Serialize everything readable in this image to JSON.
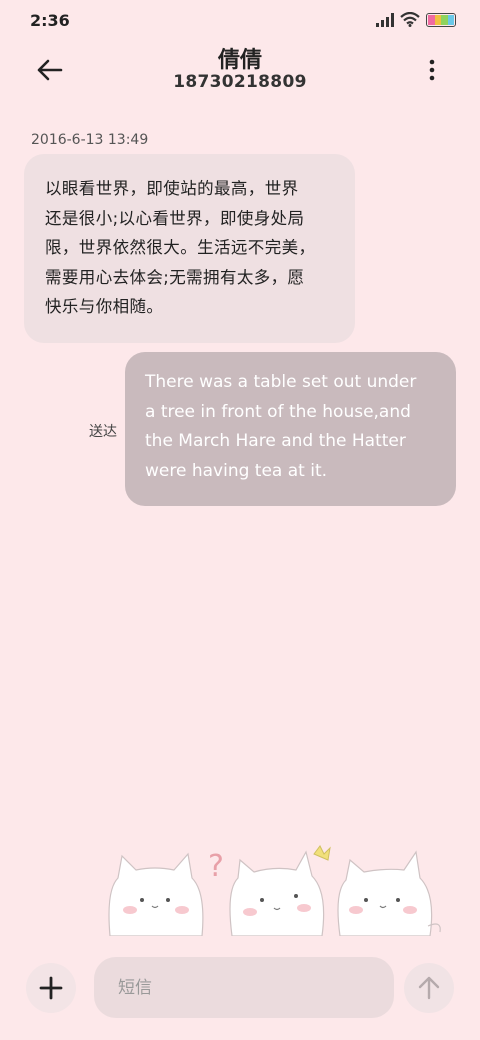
{
  "status_bar": {
    "time": "2:36",
    "battery_colors": [
      "#f06aa0",
      "#f0c040",
      "#8fd35e",
      "#6ac8e8"
    ]
  },
  "header": {
    "contact_name": "倩倩",
    "contact_number": "18730218809",
    "back_icon": "arrow-left-icon",
    "more_icon": "more-vertical-icon"
  },
  "conversation": {
    "timestamp": "2016-6-13 13:49",
    "incoming": {
      "lines": [
        "以眼看世界，即使站的最高，世界",
        "还是很小;以心看世界，即使身处局",
        "限，世界依然很大。生活远不完美，",
        "需要用心去体会;无需拥有太多，愿",
        "快乐与你相随。"
      ]
    },
    "outgoing": {
      "status": "送达",
      "lines": [
        "There was a table set out under",
        "a tree in front of the house,and",
        "the March Hare and the Hatter",
        "were having tea at it."
      ]
    }
  },
  "compose": {
    "placeholder": "短信",
    "add_icon": "plus-icon",
    "send_icon": "arrow-up-icon"
  },
  "theme": {
    "background": "#fde8ea",
    "incoming_bubble": "#efe0e2",
    "outgoing_bubble": "#c9babd"
  }
}
